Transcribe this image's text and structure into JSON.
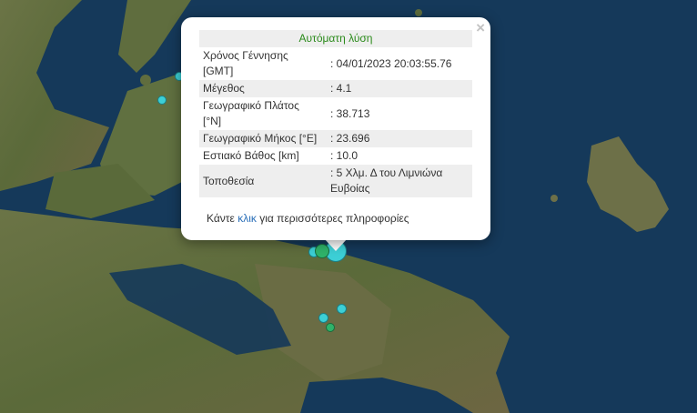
{
  "popup": {
    "title": "Αυτόματη λύση",
    "close_label": "×",
    "rows": [
      {
        "label": "Χρόνος Γέννησης [GMT]",
        "value": ": 04/01/2023 20:03:55.76"
      },
      {
        "label": "Μέγεθος",
        "value": ": 4.1"
      },
      {
        "label": "Γεωγραφικό Πλάτος [°N]",
        "value": ": 38.713"
      },
      {
        "label": "Γεωγραφικό Μήκος [°E]",
        "value": ": 23.696"
      },
      {
        "label": "Εστιακό Βάθος [km]",
        "value": ": 10.0"
      },
      {
        "label": "Τοποθεσία",
        "value": ": 5 Χλμ. Δ του Λιμνιώνα Ευβοίας"
      }
    ],
    "more_prefix": "Κάντε ",
    "more_link": "κλικ",
    "more_suffix": " για περισσότερες πληροφορίες"
  },
  "markers": [
    {
      "name": "quake-marker-1",
      "color": "#3ccfd6"
    },
    {
      "name": "quake-marker-2",
      "color": "#3ccfd6"
    },
    {
      "name": "quake-marker-3",
      "color": "#3ccfd6"
    },
    {
      "name": "quake-marker-4",
      "color": "#3ccfd6"
    },
    {
      "name": "quake-marker-5",
      "color": "#2fb36a"
    },
    {
      "name": "quake-marker-6",
      "color": "#3ccfd6"
    },
    {
      "name": "quake-marker-7",
      "color": "#3ccfd6"
    },
    {
      "name": "quake-marker-8",
      "color": "#2fb36a"
    }
  ],
  "colors": {
    "sea": "#143a55",
    "land": "#5a6b3c",
    "marker_cyan": "#3ccfd6",
    "marker_green": "#2fb36a",
    "popup_title": "#2a8a1a",
    "link": "#2a6fb8"
  }
}
